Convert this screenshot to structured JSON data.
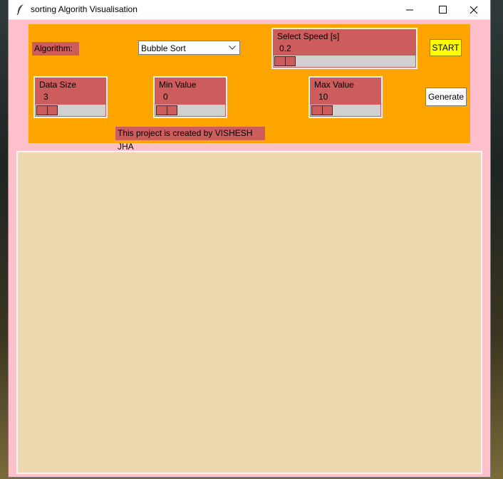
{
  "window": {
    "title": "sorting Algorith Visualisation",
    "icon": "feather-icon",
    "controls": [
      "minimize-icon",
      "maximize-icon",
      "close-icon"
    ]
  },
  "controls": {
    "algorithm_label": "Algorithm:",
    "algorithm_selected": "Bubble Sort",
    "speed": {
      "label": "Select Speed [s]",
      "value": "0.2",
      "position": 0.0
    },
    "data_size": {
      "label": "Data Size",
      "value": "3",
      "position": 0.0
    },
    "min_value": {
      "label": "Min Value",
      "value": "0",
      "position": 0.0
    },
    "max_value": {
      "label": "Max Value",
      "value": "10",
      "position": 0.0
    },
    "start_label": "START",
    "generate_label": "Generate",
    "credit": "This project is created by VISHESH JHA"
  },
  "colors": {
    "window_bg": "#ffc0cb",
    "control_panel": "#ffa500",
    "widget_bg": "#cd5c5c",
    "start_button": "#ffff00",
    "canvas_bg": "#ecd9b0"
  }
}
